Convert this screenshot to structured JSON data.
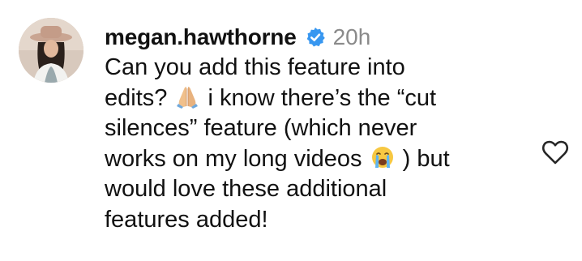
{
  "comment": {
    "username": "megan.hawthorne",
    "time": "20h",
    "lines": [
      [
        "Can you add this feature into"
      ],
      [
        "edits? ",
        " i know there’s the “cut"
      ],
      [
        "silences” feature (which never"
      ],
      [
        "works on my long videos ",
        ") but"
      ],
      [
        "would love these additional"
      ],
      [
        "features added!"
      ]
    ],
    "emojis": [
      "folded-hands",
      "loudly-crying-face"
    ]
  },
  "icons": {
    "verified": "verified-badge-icon",
    "like": "heart-outline-icon"
  },
  "colors": {
    "text": "#111111",
    "muted": "#8a8a8a",
    "verified": "#3897f0",
    "heart": "#262626"
  }
}
